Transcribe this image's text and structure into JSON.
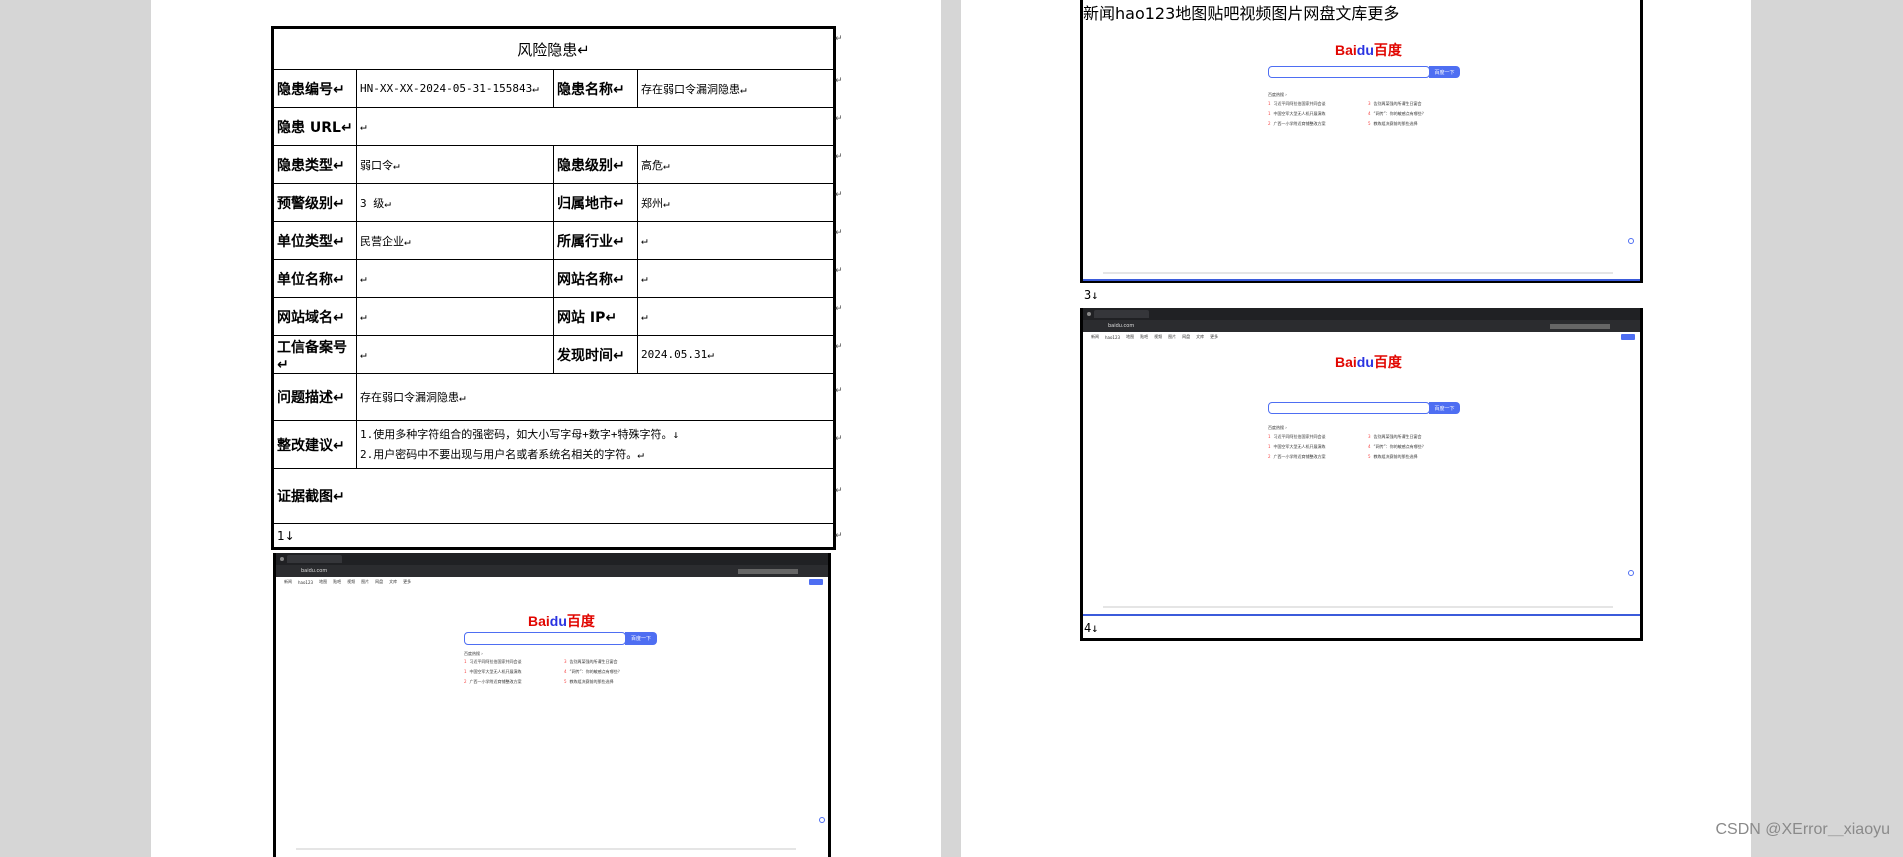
{
  "document": {
    "title": "风险隐患↵",
    "rows": {
      "id_label": "隐患编号↵",
      "id_value": "HN-XX-XX-2024-05-31-155843↵",
      "name_label": "隐患名称↵",
      "name_value": "存在弱口令漏洞隐患↵",
      "url_label": "隐患 URL↵",
      "url_value": "↵",
      "type_label": "隐患类型↵",
      "type_value": "弱口令↵",
      "level_label": "隐患级别↵",
      "level_value": "高危↵",
      "warn_label": "预警级别↵",
      "warn_value": "3 级↵",
      "city_label": "归属地市↵",
      "city_value": "郑州↵",
      "unit_type_label": "单位类型↵",
      "unit_type_value": "民营企业↵",
      "industry_label": "所属行业↵",
      "industry_value": "↵",
      "unit_name_label": "单位名称↵",
      "unit_name_value": "↵",
      "site_name_label": "网站名称↵",
      "site_name_value": "↵",
      "domain_label": "网站域名↵",
      "domain_value": "↵",
      "ip_label": "网站 IP↵",
      "ip_value": "↵",
      "icp_label": "工信备案号↵",
      "icp_value": "↵",
      "found_label": "发现时间↵",
      "found_value": "2024.05.31↵",
      "desc_label": "问题描述↵",
      "desc_value": "存在弱口令漏洞隐患↵",
      "sugg_label": "整改建议↵",
      "sugg_lines": [
        "1.使用多种字符组合的强密码，如大小写字母+数字+特殊字符。↓",
        "2.用户密码中不要出现与用户名或者系统名相关的字符。↵"
      ],
      "evidence_label": "证据截图↵",
      "fig1_label": "1↓"
    },
    "para_mark": "↵"
  },
  "page2": {
    "fig3_label": "3↓",
    "fig4_label": "4↓"
  },
  "baidu": {
    "logo_text": "Bai",
    "logo_paw": "du",
    "logo_cn": "百度",
    "search_button": "百度一下",
    "url": "baidu.com",
    "hot_title": "百度热搜 ›",
    "nav_links": [
      "新闻",
      "hao123",
      "地图",
      "贴吧",
      "视频",
      "图片",
      "网盘",
      "文库",
      "更多"
    ],
    "hot_items": [
      {
        "n": "1",
        "t": "习近平同阿拉伯国家共同会谈"
      },
      {
        "n": "1",
        "t": "中国空军大型无人机开展演练"
      },
      {
        "n": "2",
        "t": "广西一小学附近商铺整改方案"
      },
      {
        "n": "3",
        "t": "告别周某强的所谓生日宴会"
      },
      {
        "n": "4",
        "t": "“网传”：你的敏感点有哪些？"
      },
      {
        "n": "5",
        "t": "教练组决赛前的那些选择"
      }
    ]
  },
  "watermark": "CSDN @XError＿xiaoyu",
  "colors": {
    "accent": "#4e6ef2",
    "baidu_red": "#e10601",
    "baidu_blue": "#2932e1"
  }
}
